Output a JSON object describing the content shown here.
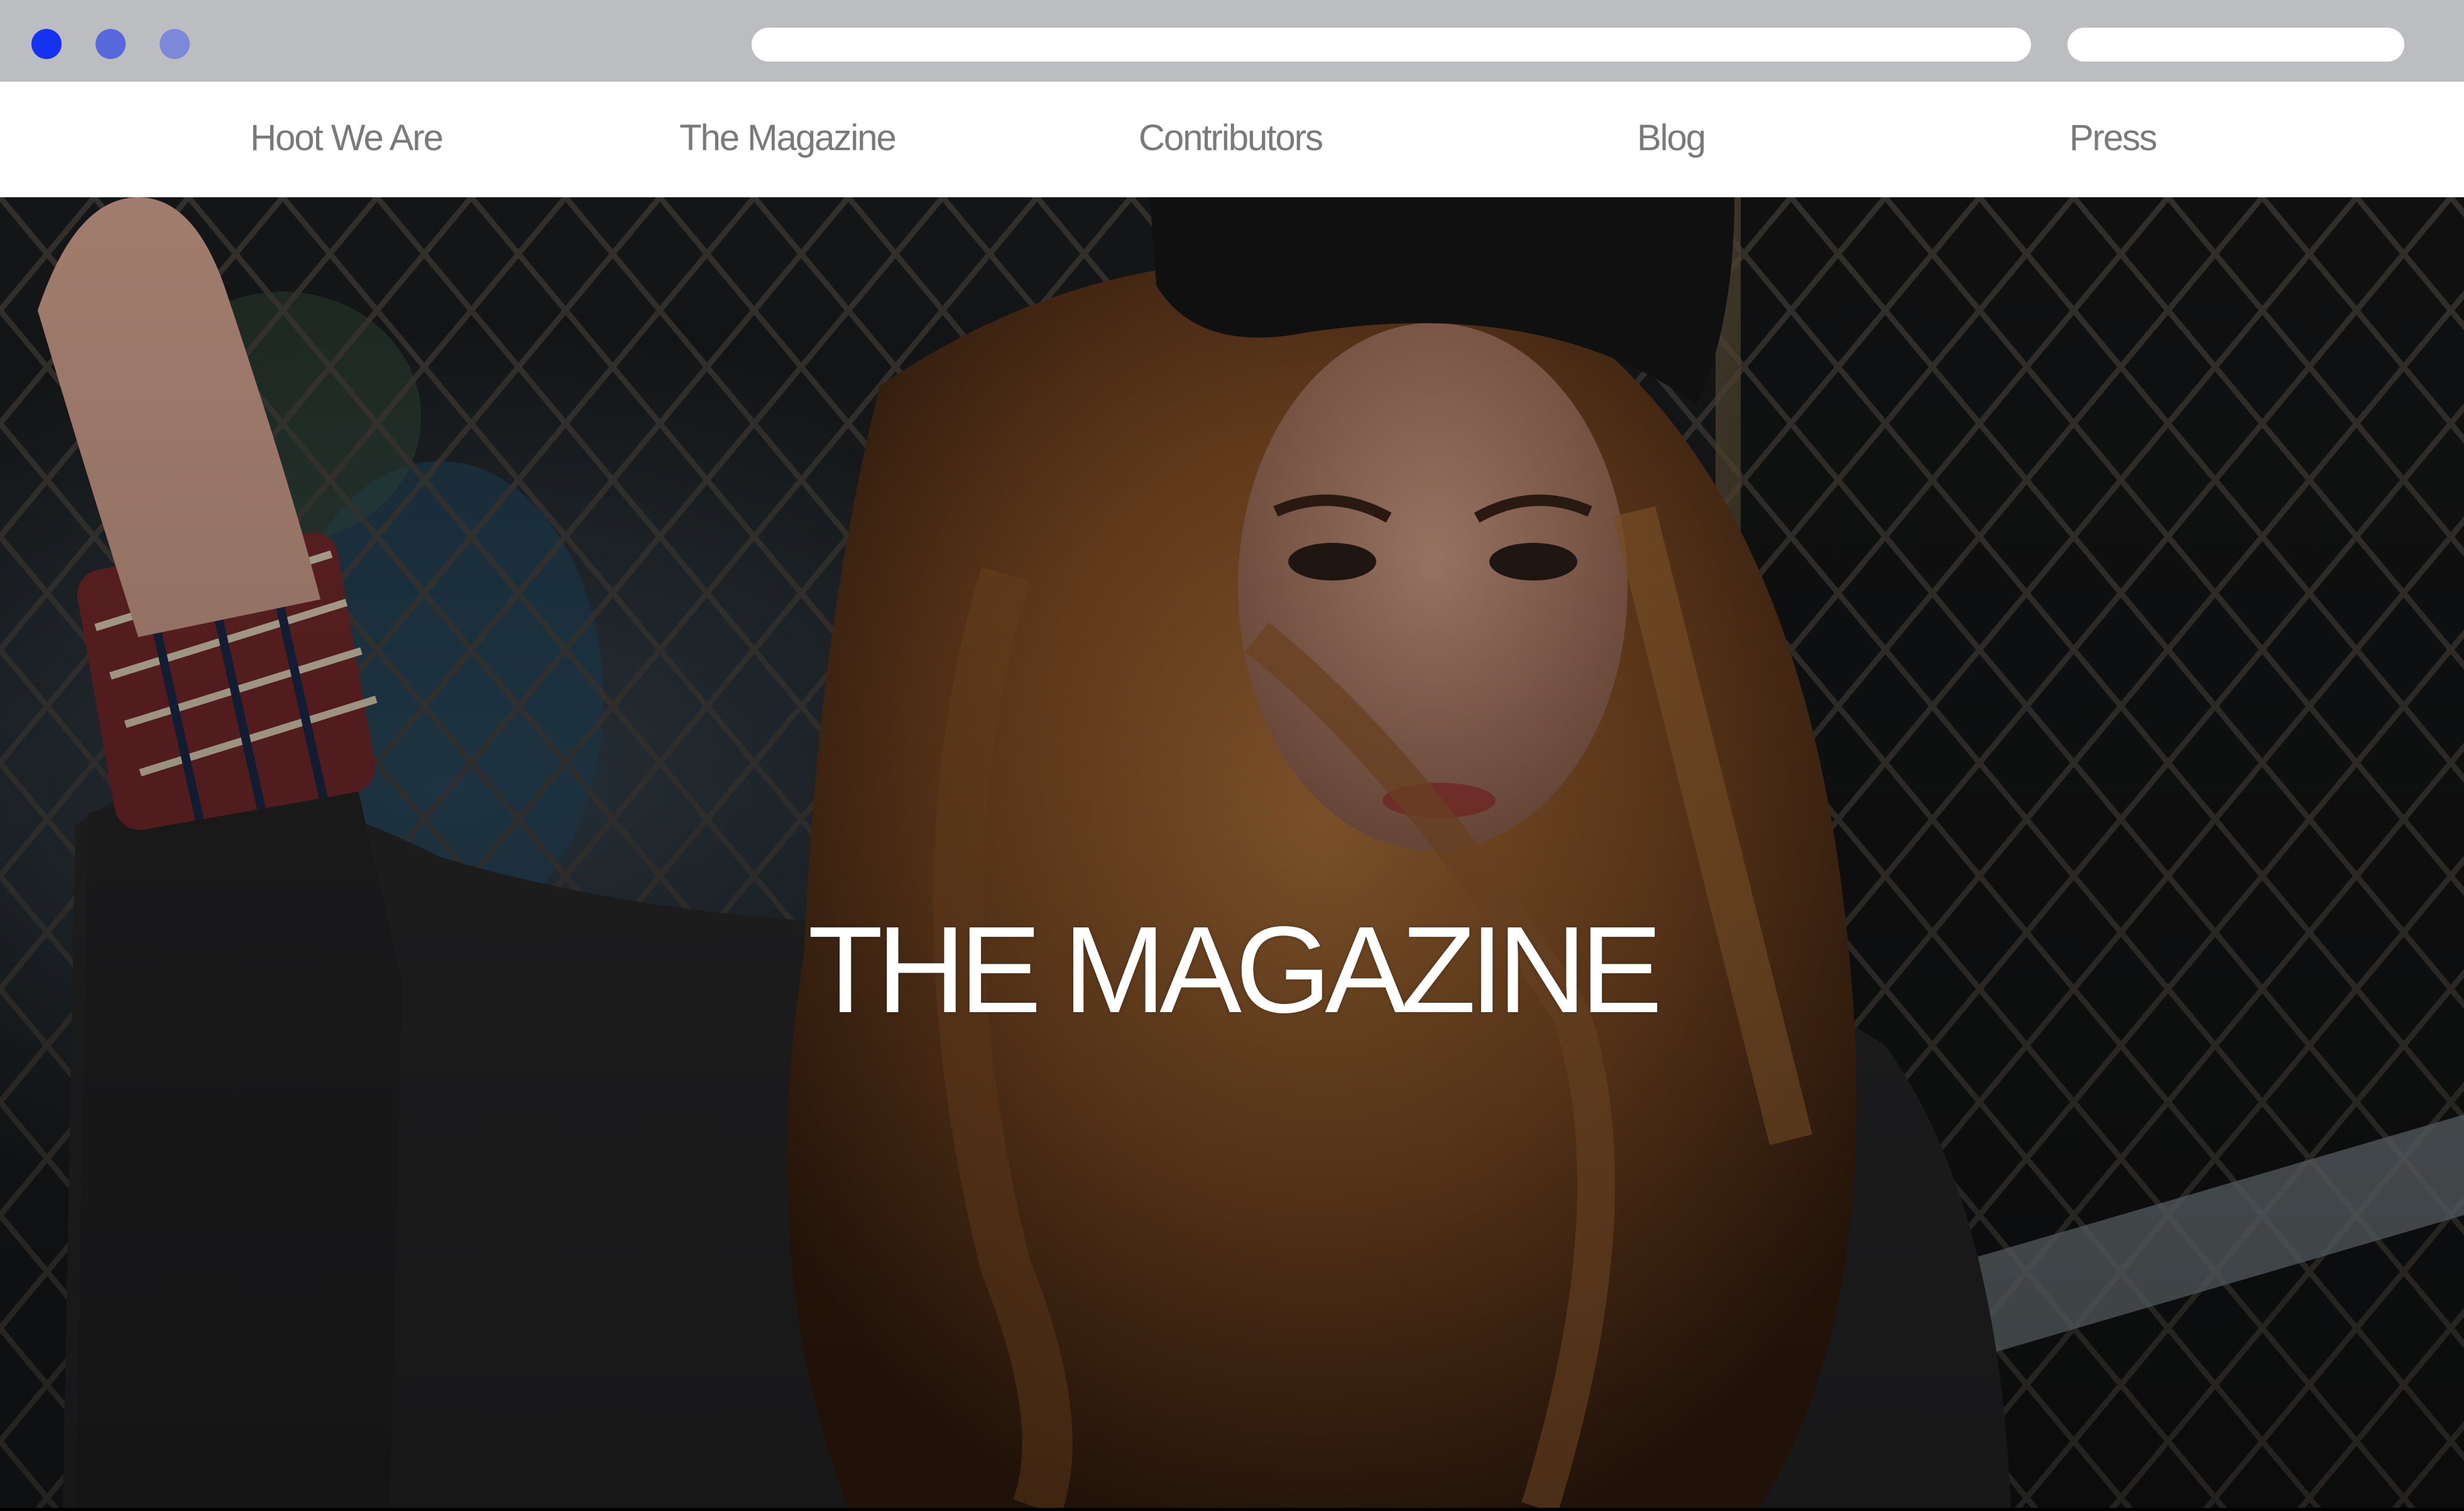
{
  "browser": {
    "window_controls": [
      "close",
      "minimize",
      "maximize"
    ],
    "url_bar_value": "",
    "search_bar_value": ""
  },
  "nav": {
    "items": [
      {
        "label": "Hoot We Are"
      },
      {
        "label": "The Magazine"
      },
      {
        "label": "Contributors"
      },
      {
        "label": "Blog"
      },
      {
        "label": "Press"
      }
    ]
  },
  "hero": {
    "title": "THE MAGAZINE",
    "image_description_icon": "photo-background"
  },
  "colors": {
    "chrome": "#bcbdc0",
    "close_dot": "#1432f0",
    "minimize_dot": "#5668dc",
    "maximize_dot": "#7b89d8",
    "nav_text": "#7a7a7a",
    "hero_title": "#ffffff"
  }
}
